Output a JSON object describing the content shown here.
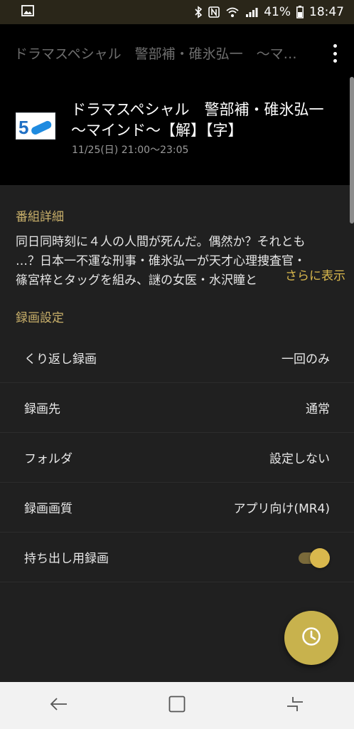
{
  "status_bar": {
    "battery": "41%",
    "time": "18:47"
  },
  "app_bar": {
    "title": "ドラマスペシャル　警部補・碓氷弘一　～マイ..."
  },
  "program": {
    "title": "ドラマスペシャル　警部補・碓氷弘一　～マインド～【解】【字】",
    "datetime": "11/25(日) 21:00～23:05",
    "channel_number": "5"
  },
  "details": {
    "heading": "番組詳細",
    "lines": [
      "同日同時刻に４人の人間が死んだ。偶然か？それとも",
      "…？日本一不運な刑事・碓氷弘一が天才心理捜査官・",
      "篠宮梓とタッグを組み、謎の女医・水沢瞳と"
    ],
    "more_label": "さらに表示"
  },
  "recording": {
    "heading": "録画設定",
    "rows": [
      {
        "label": "くり返し録画",
        "value": "一回のみ"
      },
      {
        "label": "録画先",
        "value": "通常"
      },
      {
        "label": "フォルダ",
        "value": "設定しない"
      },
      {
        "label": "録画画質",
        "value": "アプリ向け(MR4)"
      }
    ],
    "carry_out": {
      "label": "持ち出し用録画",
      "enabled": true
    }
  },
  "colors": {
    "accent": "#d9b84d",
    "section_heading": "#c9b06a",
    "fab": "#c8b24d",
    "background": "#202020"
  },
  "icons": {
    "fab": "clock-icon",
    "nav_back": "back-icon",
    "nav_home": "home-icon",
    "nav_recents": "recents-icon"
  }
}
